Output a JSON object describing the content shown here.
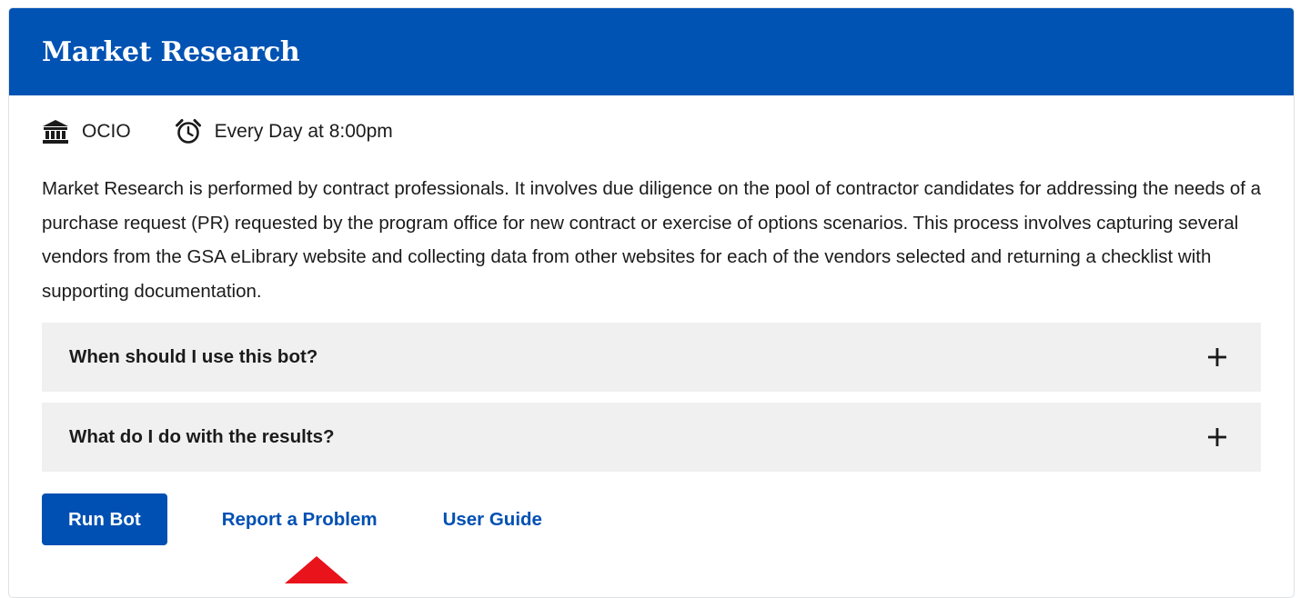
{
  "card": {
    "title": "Market Research",
    "meta": {
      "office_icon": "bank-building-icon",
      "office": "OCIO",
      "schedule_icon": "alarm-clock-icon",
      "schedule": "Every Day at 8:00pm"
    },
    "description": "Market Research is performed by contract professionals. It involves due diligence on the pool of contractor candidates for addressing the needs of a purchase request (PR) requested by the program office for new contract or exercise of options scenarios. This process involves capturing several vendors from the GSA eLibrary website and collecting data from other websites for each of the vendors selected and returning a checklist with supporting documentation.",
    "accordion": [
      {
        "title": "When should I use this bot?",
        "icon": "plus-icon"
      },
      {
        "title": "What do I do with the results?",
        "icon": "plus-icon"
      }
    ],
    "actions": {
      "run_label": "Run Bot",
      "report_label": "Report a Problem",
      "guide_label": "User Guide"
    }
  },
  "colors": {
    "header_bg": "#0052b3",
    "link": "#0050b3",
    "accordion_bg": "#f0f0f0",
    "pointer": "#e8131b"
  }
}
